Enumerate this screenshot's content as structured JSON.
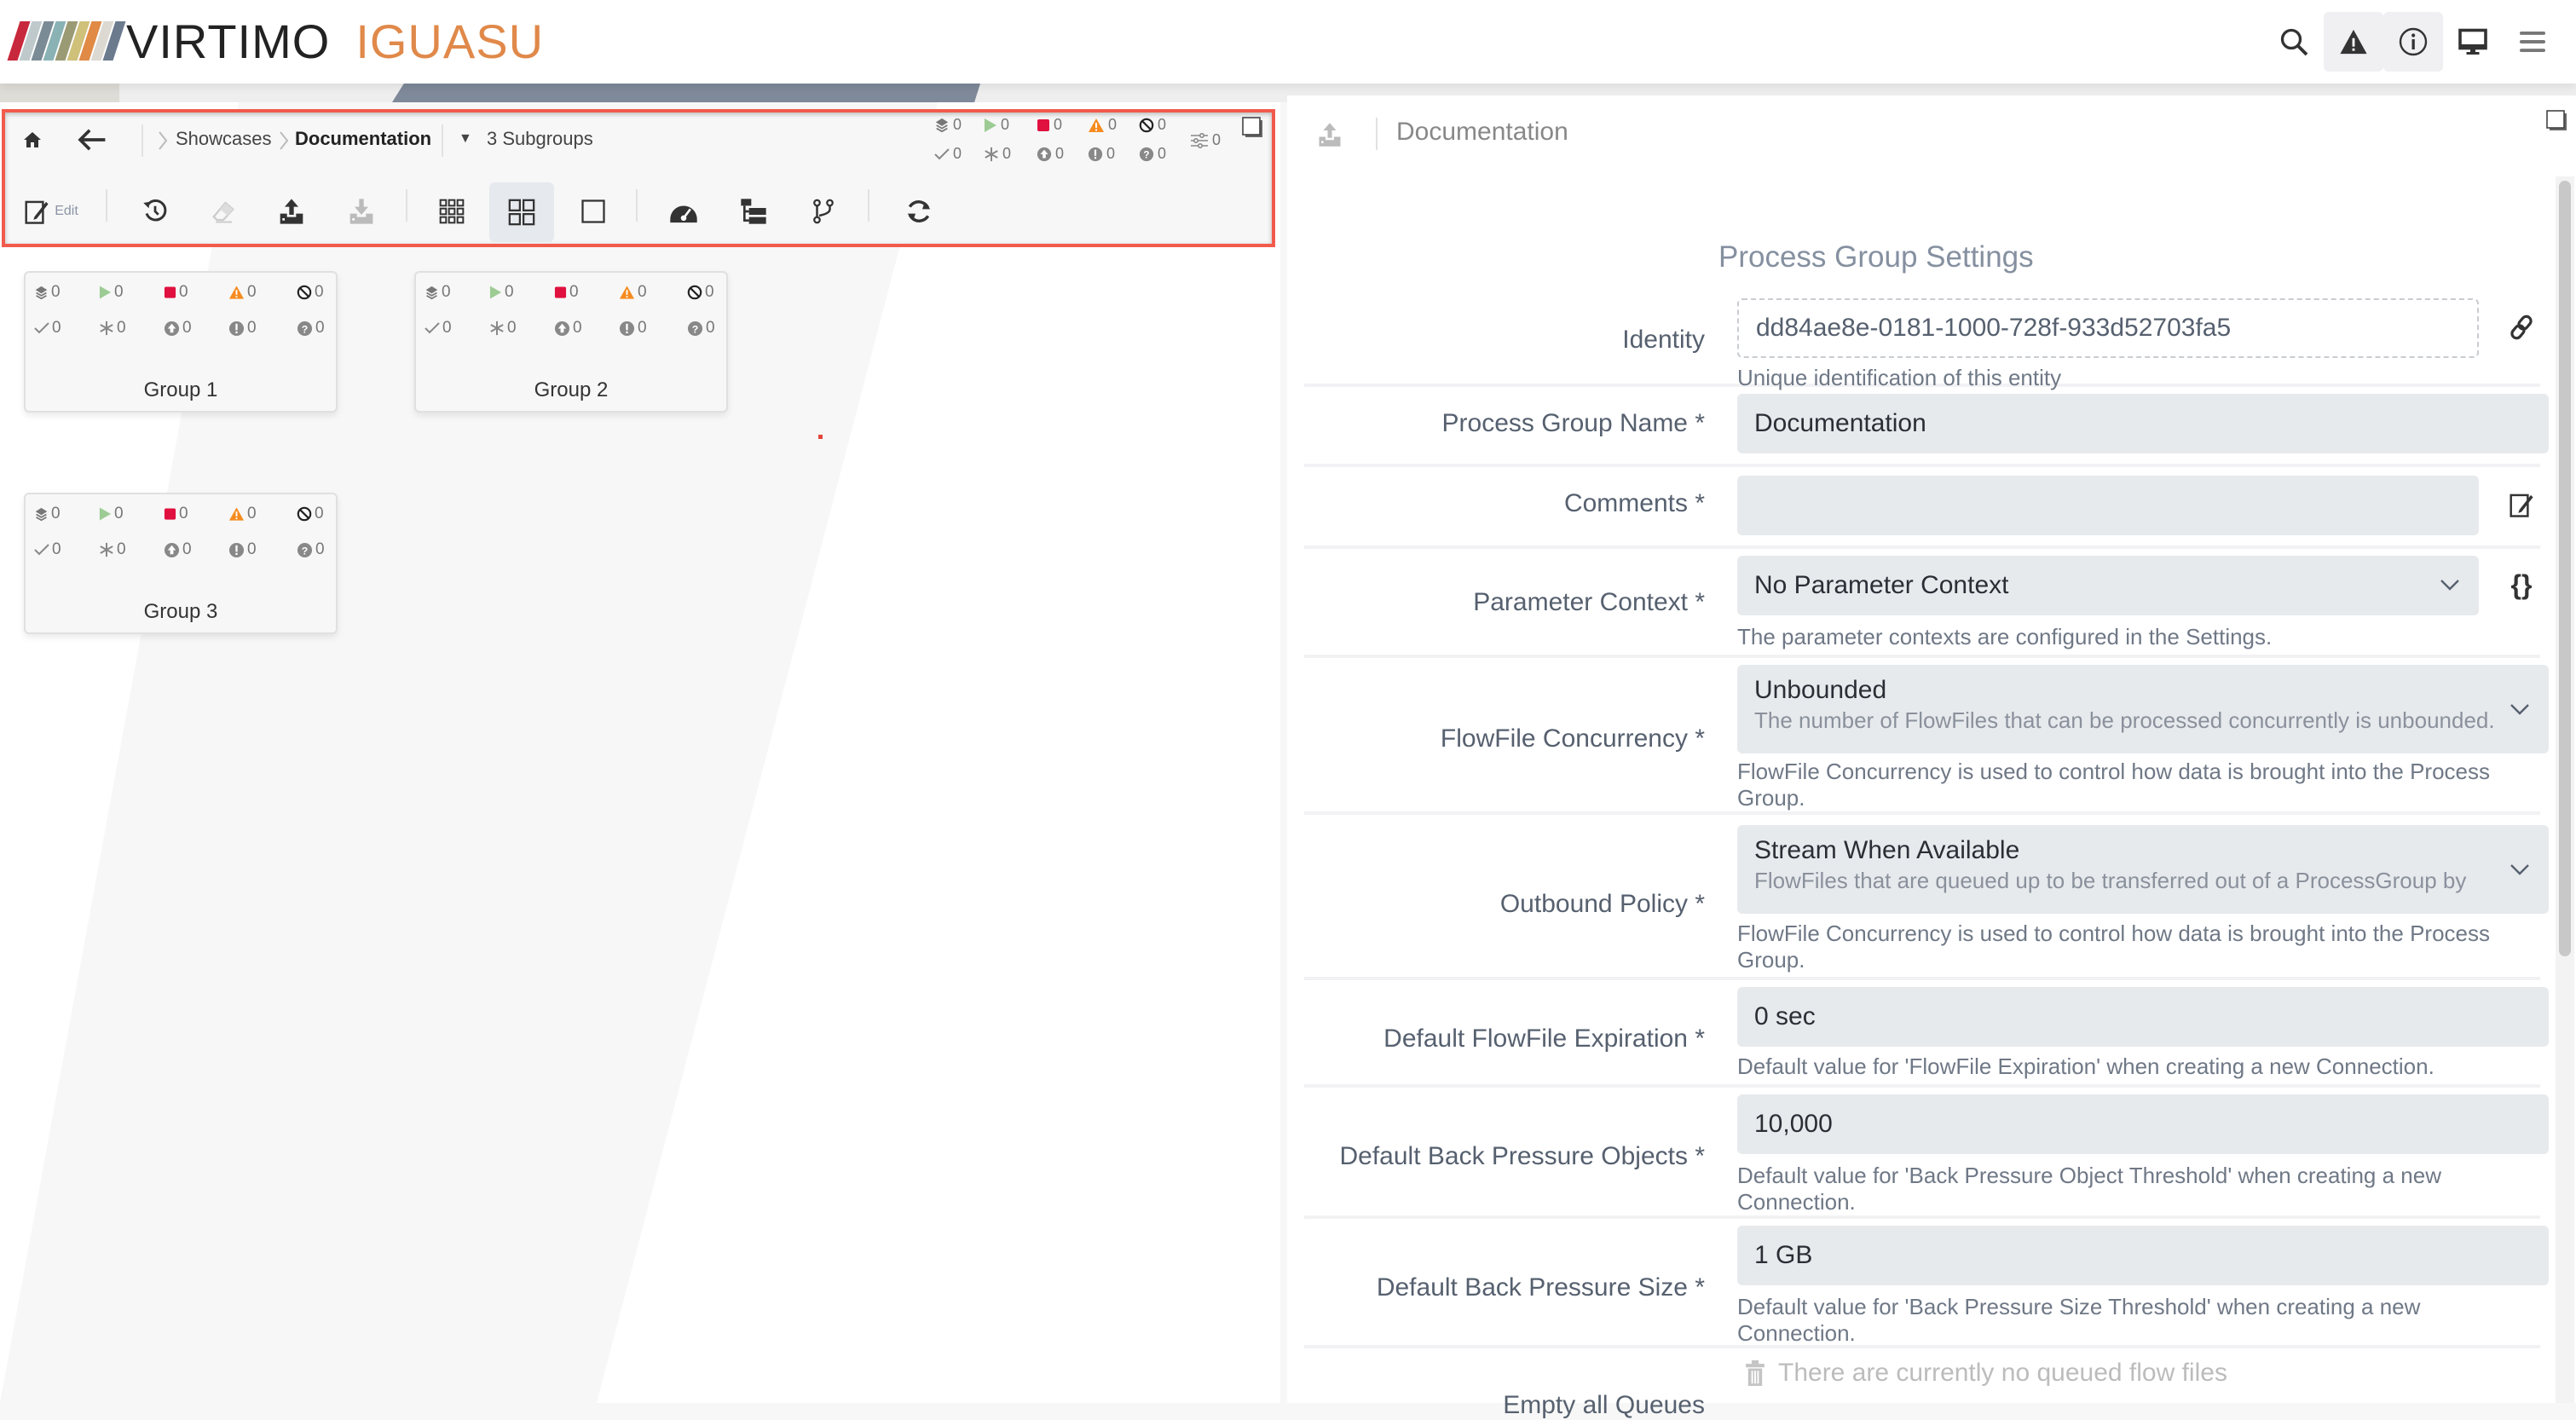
{
  "header": {
    "brand": "VIRTIMO",
    "product": "IGUASU",
    "logo_colors": [
      "#c8283c",
      "#bfc9cc",
      "#7b8b96",
      "#8ab2b5",
      "#9a9b74",
      "#cfc07a",
      "#e08a46",
      "#dcd9d3",
      "#6b7a8d"
    ],
    "icons": [
      {
        "name": "search-icon",
        "label": "Search"
      },
      {
        "name": "alert-icon",
        "label": "Alerts"
      },
      {
        "name": "info-icon",
        "label": "Info"
      },
      {
        "name": "monitor-icon",
        "label": "Display"
      },
      {
        "name": "menu-icon",
        "label": "Menu"
      }
    ]
  },
  "toolbar": {
    "breadcrumb": [
      "Showcases",
      "Documentation"
    ],
    "subgroups_label": "3 Subgroups",
    "edit_label": "Edit",
    "stats_row1": [
      {
        "icon": "queued-icon",
        "value": "0"
      },
      {
        "icon": "running-icon",
        "value": "0"
      },
      {
        "icon": "stopped-icon",
        "value": "0"
      },
      {
        "icon": "invalid-icon",
        "value": "0"
      },
      {
        "icon": "disabled-icon",
        "value": "0"
      }
    ],
    "stats_row2": [
      {
        "icon": "up-to-date-icon",
        "value": "0"
      },
      {
        "icon": "locally-modified-icon",
        "value": "0"
      },
      {
        "icon": "stale-icon",
        "value": "0"
      },
      {
        "icon": "sync-failure-icon",
        "value": "0"
      },
      {
        "icon": "unknown-icon",
        "value": "0"
      }
    ],
    "parameters_count": "0",
    "colors": {
      "running": "#9ccb94",
      "stopped": "#e0103f",
      "invalid": "#f68b1f",
      "highlight": "#f25a4c"
    }
  },
  "groups": [
    {
      "name": "Group 1",
      "row1": [
        "0",
        "0",
        "0",
        "0",
        "0"
      ],
      "row2": [
        "0",
        "0",
        "0",
        "0",
        "0"
      ]
    },
    {
      "name": "Group 2",
      "row1": [
        "0",
        "0",
        "0",
        "0",
        "0"
      ],
      "row2": [
        "0",
        "0",
        "0",
        "0",
        "0"
      ]
    },
    {
      "name": "Group 3",
      "row1": [
        "0",
        "0",
        "0",
        "0",
        "0"
      ],
      "row2": [
        "0",
        "0",
        "0",
        "0",
        "0"
      ]
    }
  ],
  "panel": {
    "title": "Documentation",
    "section_title": "Process Group Settings",
    "fields": {
      "identity": {
        "label": "Identity",
        "value": "dd84ae8e-0181-1000-728f-933d52703fa5",
        "help": "Unique identification of this entity"
      },
      "name": {
        "label": "Process Group Name *",
        "value": "Documentation"
      },
      "comments": {
        "label": "Comments *",
        "value": ""
      },
      "parameter_context": {
        "label": "Parameter Context *",
        "value": "No Parameter Context",
        "help": "The parameter contexts are configured in the Settings."
      },
      "concurrency": {
        "label": "FlowFile Concurrency *",
        "value": "Unbounded",
        "sub": "The number of FlowFiles that can be processed concurrently is unbounded.",
        "help": "FlowFile Concurrency is used to control how data is brought into the Process Group."
      },
      "outbound": {
        "label": "Outbound Policy *",
        "value": "Stream When Available",
        "sub": "FlowFiles that are queued up to be transferred out of a ProcessGroup by",
        "help": "FlowFile Concurrency is used to control how data is brought into the Process Group."
      },
      "expiration": {
        "label": "Default FlowFile Expiration *",
        "value": "0 sec",
        "help": "Default value for 'FlowFile Expiration' when creating a new Connection."
      },
      "bp_objects": {
        "label": "Default Back Pressure Objects *",
        "value": "10,000",
        "help": "Default value for 'Back Pressure Object Threshold' when creating a new Connection."
      },
      "bp_size": {
        "label": "Default Back Pressure Size *",
        "value": "1 GB",
        "help": "Default value for 'Back Pressure Size Threshold' when creating a new Connection."
      },
      "empty_queues": {
        "label": "Empty all Queues",
        "value": "There are currently no queued flow files"
      }
    }
  }
}
